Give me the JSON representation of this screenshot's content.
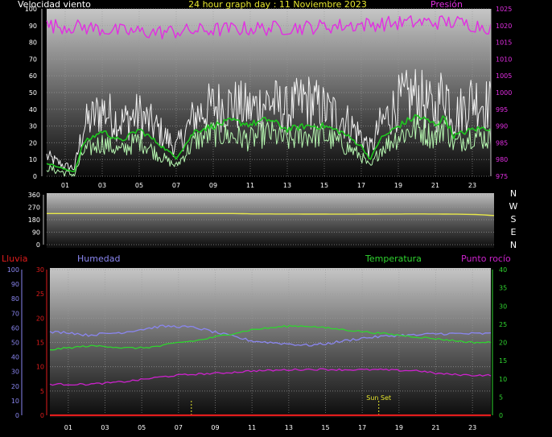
{
  "header": {
    "title": "24 hour graph day : 11 Noviembre 2023",
    "wind_label": "Velocidad viento",
    "pressure_label": "Presión"
  },
  "direction_panel": {
    "compass_letters": [
      "N",
      "W",
      "S",
      "E",
      "N"
    ]
  },
  "bottom_panel": {
    "rain_label": "Lluvia",
    "humidity_label": "Humedad",
    "temperature_label": "Temperatura",
    "dewpoint_label": "Punto rocío",
    "sunset_label": "Sun Set"
  },
  "colors": {
    "pressure": "#e22ee2",
    "wind_gust": "#f2f2f2",
    "wind_speed": "#b6f7b0",
    "wind_avg": "#1ec81e",
    "direction": "#e8e84a",
    "humidity": "#8a86f0",
    "temperature": "#2fd42f",
    "dewpoint": "#cc22cc",
    "rain": "#e01c1c",
    "title": "#e6e62e",
    "sun_marker": "#e6e62e"
  },
  "chart_data": [
    {
      "type": "line",
      "name": "wind-and-pressure",
      "title": "24 hour graph day : 11 Noviembre 2023",
      "x_ticks": [
        "01",
        "03",
        "05",
        "07",
        "09",
        "11",
        "13",
        "15",
        "17",
        "19",
        "21",
        "23"
      ],
      "x_range_hours": [
        0,
        24
      ],
      "y_left_label": "Velocidad viento",
      "y_left_range": [
        0,
        100
      ],
      "y_left_ticks": [
        0,
        10,
        20,
        30,
        40,
        50,
        60,
        70,
        80,
        90,
        100
      ],
      "y_right_label": "Presión",
      "y_right_range": [
        975,
        1025
      ],
      "y_right_ticks": [
        975,
        980,
        985,
        990,
        995,
        1000,
        1005,
        1010,
        1015,
        1020,
        1025
      ],
      "series": [
        {
          "key": "pressure",
          "axis": "right",
          "hours": [
            0,
            2,
            4,
            6,
            8,
            10,
            12,
            14,
            16,
            18,
            20,
            22,
            24
          ],
          "values": [
            1020,
            1019.5,
            1018.3,
            1018,
            1018.5,
            1019,
            1019.2,
            1019.5,
            1020,
            1020.5,
            1021,
            1021,
            1019.5
          ]
        },
        {
          "key": "wind_gust",
          "axis": "left",
          "hours": [
            0,
            1,
            1.5,
            2,
            3,
            4,
            5,
            6,
            7,
            8,
            9,
            10,
            11,
            12,
            13,
            14,
            15,
            16,
            17,
            17.5,
            18,
            19,
            20,
            21,
            21.5,
            22,
            23,
            24
          ],
          "values": [
            12,
            6,
            5,
            30,
            40,
            32,
            37,
            28,
            17,
            36,
            42,
            43,
            40,
            45,
            39,
            46,
            40,
            35,
            24,
            16,
            30,
            44,
            49,
            38,
            55,
            35,
            47,
            42
          ]
        },
        {
          "key": "wind_speed",
          "axis": "left",
          "hours": [
            0,
            1,
            1.5,
            2,
            3,
            4,
            5,
            6,
            7,
            8,
            9,
            10,
            11,
            12,
            13,
            14,
            15,
            16,
            17,
            17.5,
            18,
            19,
            20,
            21,
            21.5,
            22,
            23,
            24
          ],
          "values": [
            5,
            2,
            1,
            15,
            20,
            15,
            22,
            13,
            6,
            21,
            26,
            24,
            22,
            26,
            21,
            25,
            24,
            19,
            12,
            5,
            16,
            24,
            29,
            23,
            32,
            19,
            25,
            22
          ]
        },
        {
          "key": "wind_avg",
          "axis": "left",
          "hours": [
            0,
            1,
            1.5,
            2,
            3,
            4,
            5,
            6,
            7,
            8,
            9,
            10,
            11,
            12,
            13,
            14,
            15,
            16,
            17,
            17.5,
            18,
            19,
            20,
            21,
            21.5,
            22,
            23,
            24
          ],
          "values": [
            8,
            4,
            3,
            20,
            27,
            21,
            28,
            20,
            11,
            27,
            30,
            33,
            31,
            34,
            28,
            30,
            30,
            26,
            18,
            10,
            22,
            30,
            36,
            31,
            35,
            24,
            28,
            29
          ]
        }
      ]
    },
    {
      "type": "line",
      "name": "wind-direction",
      "x_range_hours": [
        0,
        24
      ],
      "y_range": [
        0,
        360
      ],
      "y_ticks": [
        0,
        90,
        180,
        270,
        360
      ],
      "y_tick_labels": [
        "0",
        "90",
        "180",
        "270",
        "360"
      ],
      "series": [
        {
          "key": "direction",
          "hours": [
            0,
            6,
            10,
            11,
            16,
            20,
            22,
            23,
            24
          ],
          "values": [
            225,
            225,
            225,
            222,
            220,
            222,
            220,
            218,
            210
          ]
        }
      ]
    },
    {
      "type": "line",
      "name": "temp-humidity-rain",
      "x_ticks": [
        "01",
        "03",
        "05",
        "07",
        "09",
        "11",
        "13",
        "15",
        "17",
        "19",
        "21",
        "23"
      ],
      "x_range_hours": [
        0,
        24
      ],
      "y_humidity_range": [
        0,
        100
      ],
      "y_humidity_ticks": [
        0,
        10,
        20,
        30,
        40,
        50,
        60,
        70,
        80,
        90,
        100
      ],
      "y_rain_range": [
        0,
        30
      ],
      "y_rain_ticks": [
        0,
        5,
        10,
        15,
        20,
        25,
        30
      ],
      "y_temp_range": [
        0,
        40
      ],
      "y_temp_ticks": [
        0,
        5,
        10,
        15,
        20,
        25,
        30,
        35,
        40
      ],
      "series": [
        {
          "key": "humidity",
          "axis": "humidity",
          "hours": [
            0,
            1,
            2,
            3,
            4,
            5,
            6,
            7,
            8,
            9,
            10,
            11,
            12,
            13,
            14,
            15,
            16,
            17,
            18,
            19,
            20,
            21,
            22,
            23,
            24
          ],
          "values": [
            57,
            57,
            55,
            56,
            57,
            59,
            61,
            61,
            60,
            57,
            54,
            51,
            50,
            49,
            48,
            49,
            51,
            53,
            54,
            55,
            55,
            56,
            56,
            56,
            56
          ]
        },
        {
          "key": "temperature",
          "axis": "temp",
          "hours": [
            0,
            1,
            2,
            3,
            4,
            5,
            6,
            7,
            8,
            9,
            10,
            11,
            12,
            13,
            14,
            15,
            16,
            17,
            18,
            19,
            20,
            21,
            22,
            23,
            24
          ],
          "values": [
            18,
            18.5,
            19,
            19,
            18.5,
            18.5,
            19,
            20,
            20.5,
            21.5,
            22.5,
            23.5,
            24,
            24.5,
            24.5,
            24,
            23.5,
            23,
            22.5,
            22,
            21.5,
            21,
            20.5,
            20,
            20
          ]
        },
        {
          "key": "dewpoint",
          "axis": "temp",
          "hours": [
            0,
            1,
            2,
            3,
            4,
            5,
            6,
            7,
            8,
            9,
            10,
            11,
            12,
            13,
            14,
            15,
            16,
            17,
            18,
            19,
            20,
            21,
            22,
            23,
            24
          ],
          "values": [
            8.5,
            8.5,
            8.5,
            8.8,
            9.2,
            9.8,
            10.5,
            11,
            11.3,
            11.5,
            11.8,
            12.2,
            12.3,
            12.5,
            12.6,
            12.6,
            12.5,
            12.5,
            12.5,
            12.3,
            12.3,
            11.5,
            11.2,
            11,
            11
          ]
        },
        {
          "key": "rain",
          "axis": "rain",
          "hours": [
            0,
            24
          ],
          "values": [
            0,
            0
          ]
        }
      ],
      "markers": [
        {
          "label": "",
          "hour": 7.7
        },
        {
          "label": "Sun Set",
          "hour": 17.9
        }
      ]
    }
  ]
}
